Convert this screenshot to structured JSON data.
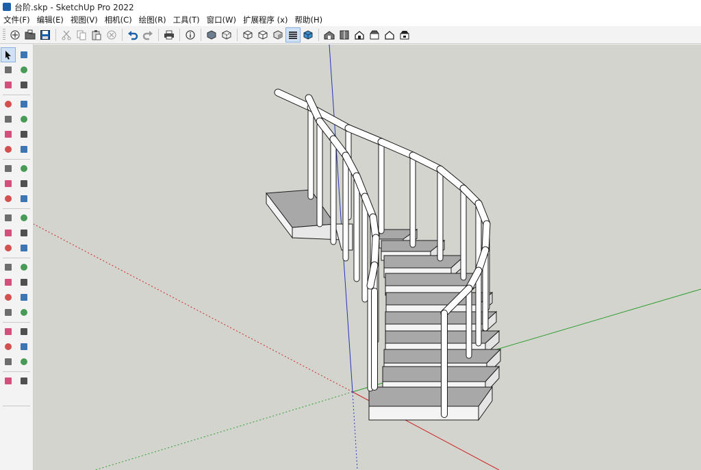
{
  "title_bar": {
    "title": "台阶.skp - SketchUp Pro 2022"
  },
  "menu": [
    "文件(F)",
    "编辑(E)",
    "视图(V)",
    "相机(C)",
    "绘图(R)",
    "工具(T)",
    "窗口(W)",
    "扩展程序 (x)",
    "帮助(H)"
  ],
  "toolbar_icons": [
    "new-file-icon",
    "open-folder-icon",
    "save-icon",
    "cut-icon",
    "copy-icon",
    "paste-icon",
    "erase-selection-icon",
    "undo-icon",
    "redo-icon",
    "print-icon",
    "model-info-icon",
    "xray-icon",
    "back-edges-icon",
    "wireframe-icon",
    "hidden-line-icon",
    "shaded-icon",
    "shaded-with-textures-icon",
    "monochrome-icon",
    "iso-view-icon",
    "top-view-icon",
    "front-view-icon",
    "right-view-icon",
    "back-view-icon",
    "left-view-icon"
  ],
  "left_tool_icons": [
    "select-icon",
    "orbit-icon",
    "paint-bucket-icon",
    "eraser-icon",
    "component-icon",
    "tag-icon",
    "line-icon",
    "freehand-icon",
    "rectangle-icon",
    "rotated-rectangle-icon",
    "circle-icon",
    "polygon-icon",
    "arc-icon",
    "pie-icon",
    "two-point-arc-icon",
    "three-point-arc-icon",
    "move-icon",
    "push-pull-icon",
    "rotate-icon",
    "follow-me-icon",
    "scale-icon",
    "offset-icon",
    "tape-measure-icon",
    "dimension-icon",
    "protractor-icon",
    "text-icon",
    "axes-icon",
    "3d-text-icon",
    "orbit-view-icon",
    "pan-icon",
    "zoom-icon",
    "zoom-window-icon",
    "zoom-extents-icon",
    "previous-view-icon",
    "position-camera-icon",
    "look-around-icon",
    "walk-icon",
    "section-plane-icon",
    "sandbox-from-contours-icon",
    "sandbox-from-scratch-icon",
    "smoove-icon",
    "stamp-icon"
  ],
  "colors": {
    "viewport_bg": "#d4d4cf",
    "axis_red": "#cc2222",
    "axis_green": "#2a9d2a",
    "axis_blue": "#2233bb",
    "step_top": "#a8a8a8",
    "step_side": "#f4f4f4",
    "edge": "#1a1a1a"
  }
}
